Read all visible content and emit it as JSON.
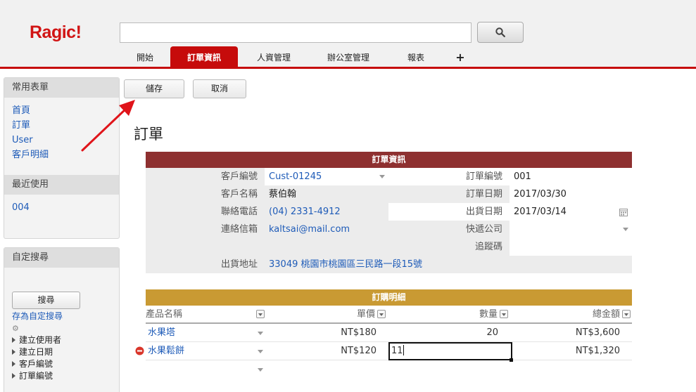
{
  "app": {
    "logo": "Ragic!"
  },
  "search": {
    "placeholder": ""
  },
  "tabs": [
    {
      "label": "開始",
      "active": false
    },
    {
      "label": "訂單資訊",
      "active": true
    },
    {
      "label": "人資管理",
      "active": false
    },
    {
      "label": "辦公室管理",
      "active": false
    },
    {
      "label": "報表",
      "active": false
    },
    {
      "label": "+",
      "active": false
    }
  ],
  "sidebar": {
    "favorites_title": "常用表單",
    "favorites": [
      "首頁",
      "訂單",
      "User",
      "客戶明細"
    ],
    "recent_title": "最近使用",
    "recent": [
      "004"
    ],
    "custom_search_title": "自定搜尋",
    "search_button": "搜尋",
    "save_search_link": "存為自定搜尋",
    "filters": [
      "建立使用者",
      "建立日期",
      "客戶編號",
      "訂單編號"
    ]
  },
  "toolbar": {
    "save_label": "儲存",
    "cancel_label": "取消"
  },
  "page_title": "訂單",
  "order_section": {
    "title": "訂單資訊",
    "customer_id_label": "客戶編號",
    "customer_id": "Cust-01245",
    "customer_name_label": "客戶名稱",
    "customer_name": "蔡伯翰",
    "phone_label": "聯絡電話",
    "phone": "(04) 2331-4912",
    "email_label": "連絡信箱",
    "email": "kaltsai@mail.com",
    "order_no_label": "訂單編號",
    "order_no": "001",
    "order_date_label": "訂單日期",
    "order_date": "2017/03/30",
    "ship_date_label": "出貨日期",
    "ship_date": "2017/03/14",
    "courier_label": "快遞公司",
    "courier": "",
    "tracking_label": "追蹤碼",
    "tracking": "",
    "address_label": "出貨地址",
    "address": "33049 桃園市桃園區三民路一段15號"
  },
  "detail_section": {
    "title": "訂購明細",
    "columns": [
      "產品名稱",
      "單價",
      "數量",
      "總金額"
    ],
    "rows": [
      {
        "product": "水果塔",
        "price": "NT$180",
        "qty": "20",
        "total": "NT$3,600"
      },
      {
        "product": "水果鬆餅",
        "price": "NT$120",
        "qty": "11",
        "total": "NT$1,320"
      }
    ]
  },
  "colors": {
    "brand": "#c60b0b",
    "order_header": "#8e3030",
    "detail_header": "#c99a33",
    "link": "#1e5bb8"
  }
}
